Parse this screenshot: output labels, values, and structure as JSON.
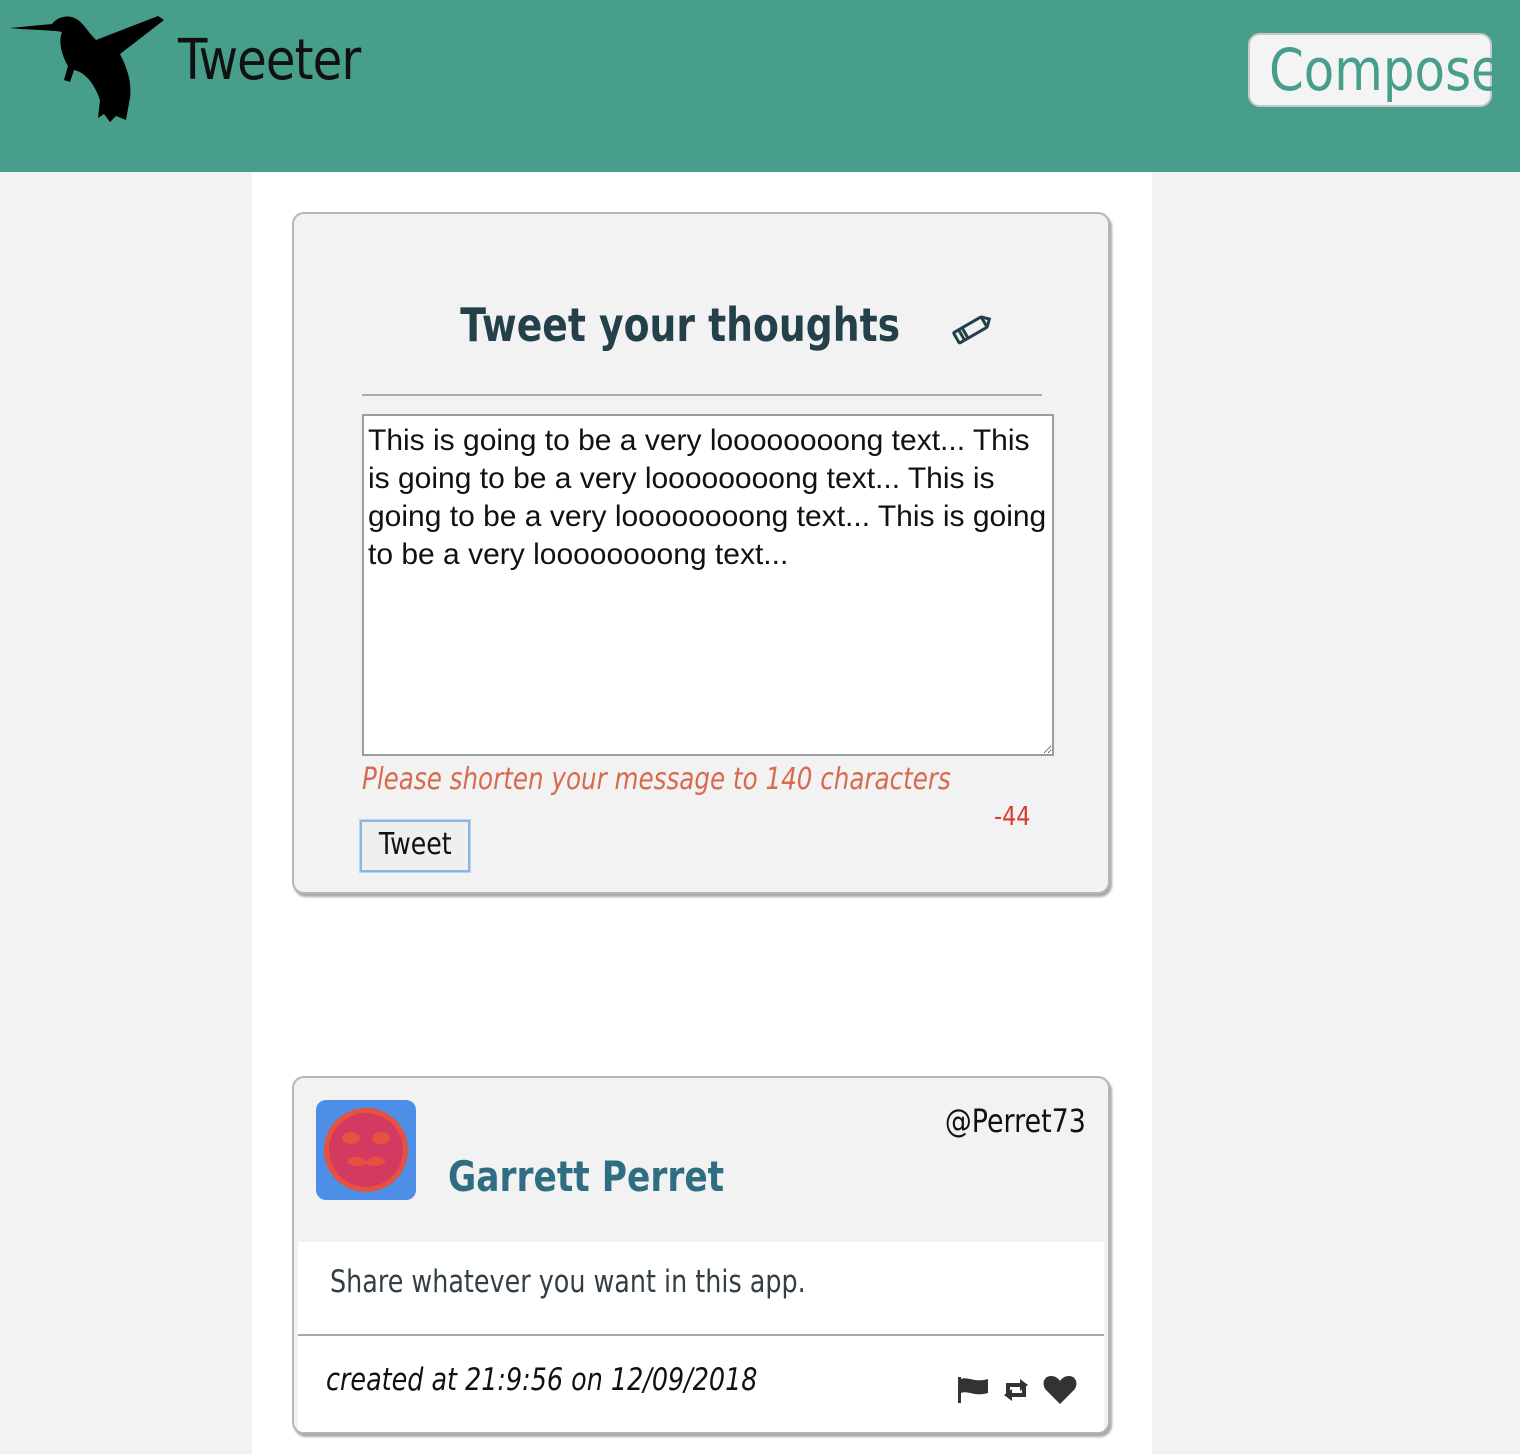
{
  "colors": {
    "nav_bg": "#479e8b",
    "accent": "#479e8b",
    "error": "#d86a4e",
    "counter": "#d93a30",
    "username": "#2f6e82",
    "avatar_bg": "#4d8ee6"
  },
  "nav": {
    "logo_icon": "hummingbird-icon",
    "brand": "Tweeter",
    "compose_label": "Compose"
  },
  "compose": {
    "title": "Tweet your thoughts",
    "title_icon": "pencil-icon",
    "textarea_value": "This is going to be a very loooooooong text... This is going to be a very loooooooong text... This is going to be a very loooooooong text... This is going to be a very loooooooong text...",
    "error_message": "Please shorten your message to 140 characters",
    "counter": "-44",
    "submit_label": "Tweet"
  },
  "tweets": [
    {
      "avatar_icon": "avatar-face-icon",
      "name": "Garrett Perret",
      "handle": "@Perret73",
      "text": "Share whatever you want in this app.",
      "created": "created at 21:9:56 on 12/09/2018",
      "actions": [
        "flag-icon",
        "retweet-icon",
        "heart-icon"
      ]
    }
  ]
}
